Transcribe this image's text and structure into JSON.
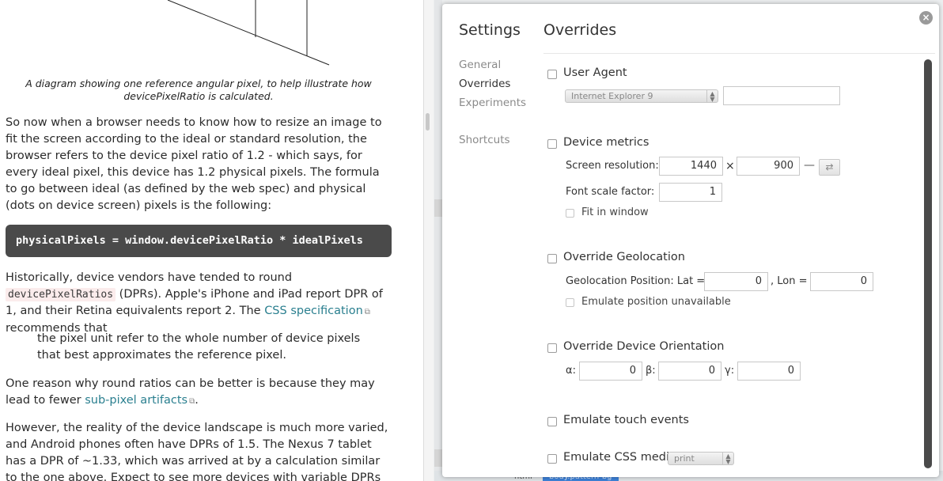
{
  "article": {
    "caption": "A diagram showing one reference angular pixel, to help illustrate how devicePixelRatio is calculated.",
    "paragraph1": "So now when a browser needs to know how to resize an image to fit the screen according to the ideal or standard resolution, the browser refers to the device pixel ratio of 1.2 - which says, for every ideal pixel, this device has 1.2 physical pixels. The formula to go between ideal (as defined by the web spec) and physical (dots on device screen) pixels is the following:",
    "code": "physicalPixels = window.devicePixelRatio * idealPixels",
    "p2_before": "Historically, device vendors have tended to round ",
    "p2_code": "devicePixelRatios",
    "p2_middle": " (DPRs). Apple's iPhone and iPad report DPR of 1, and their Retina equivalents report 2. The ",
    "p2_link": "CSS specification",
    "p2_after": " recommends that",
    "quote": "the pixel unit refer to the whole number of device pixels that best approximates the reference pixel.",
    "p3_before": "One reason why round ratios can be better is because they may lead to fewer ",
    "p3_link": "sub-pixel artifacts",
    "p3_after": ".",
    "paragraph4": "However, the reality of the device landscape is much more varied, and Android phones often have DPRs of 1.5. The Nexus 7 tablet has a DPR of ~1.33, which was arrived at by a calculation similar to the one above. Expect to see more devices with variable DPRs in the future. Because of"
  },
  "devtools": {
    "bottom_html": "html",
    "bottom_tag": "body.pattern-bg"
  },
  "settings": {
    "title": "Settings",
    "close_symbol": "×",
    "nav": [
      "General",
      "Overrides",
      "Experiments",
      "Shortcuts"
    ],
    "active_nav": "Overrides",
    "pane_title": "Overrides",
    "user_agent": {
      "label": "User Agent",
      "select_value": "Internet Explorer 9",
      "text_value": ""
    },
    "device_metrics": {
      "label": "Device metrics",
      "screen_resolution_label": "Screen resolution:",
      "width": "1440",
      "times": "×",
      "height": "900",
      "dash": "—",
      "swap_symbol": "⇄",
      "font_scale_label": "Font scale factor:",
      "font_scale": "1",
      "fit_in_window_label": "Fit in window"
    },
    "geolocation": {
      "label": "Override Geolocation",
      "position_label": "Geolocation Position: Lat =",
      "lat": "0",
      "lon_label": ", Lon =",
      "lon": "0",
      "unavailable_label": "Emulate position unavailable"
    },
    "orientation": {
      "label": "Override Device Orientation",
      "alpha_label": "α:",
      "alpha": "0",
      "beta_label": "β:",
      "beta": "0",
      "gamma_label": "γ:",
      "gamma": "0"
    },
    "touch": {
      "label": "Emulate touch events"
    },
    "css_media": {
      "label": "Emulate CSS media",
      "select_value": "print"
    }
  }
}
